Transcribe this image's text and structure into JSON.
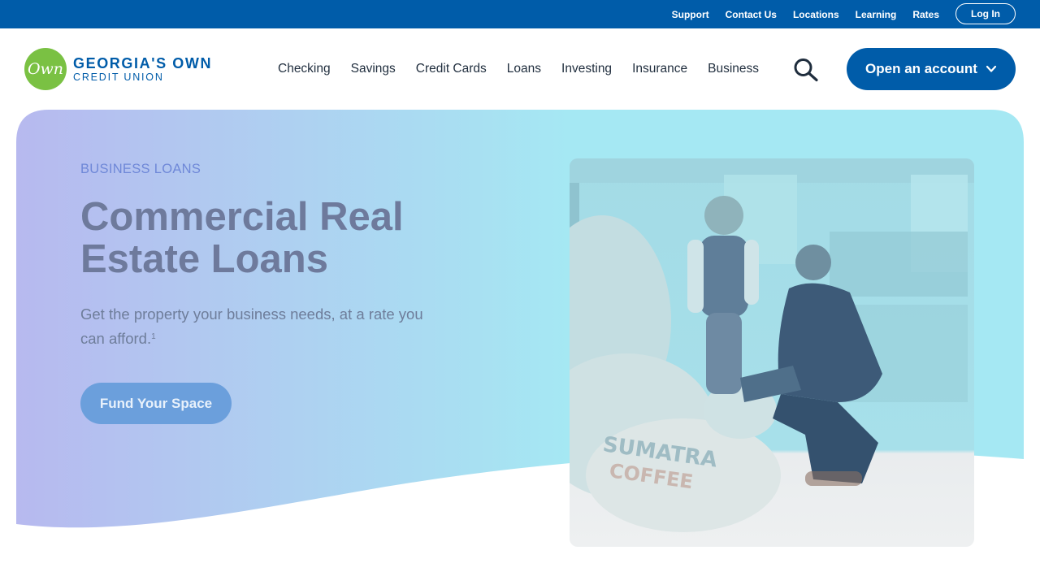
{
  "utility_nav": {
    "links": [
      "Support",
      "Contact Us",
      "Locations",
      "Learning",
      "Rates"
    ],
    "login_label": "Log In"
  },
  "brand": {
    "logo_mark": "Own",
    "name": "GEORGIA'S OWN",
    "subtitle": "CREDIT UNION",
    "color": "#005ca9",
    "logo_color": "#7ac143"
  },
  "main_nav": {
    "items": [
      "Checking",
      "Savings",
      "Credit Cards",
      "Loans",
      "Investing",
      "Insurance",
      "Business"
    ],
    "search_icon": "search-icon",
    "open_account_label": "Open an account",
    "open_account_icon": "chevron-down-icon"
  },
  "hero": {
    "eyebrow": "BUSINESS LOANS",
    "title": "Commercial Real Estate Loans",
    "description": "Get the property your business needs, at a rate you can afford.",
    "footnote": "1",
    "cta_label": "Fund Your Space",
    "gradient_start": "#b7b9ef",
    "gradient_end": "#a5e8f3",
    "photo": "Two men inspecting burlap coffee sacks in a warehouse"
  }
}
